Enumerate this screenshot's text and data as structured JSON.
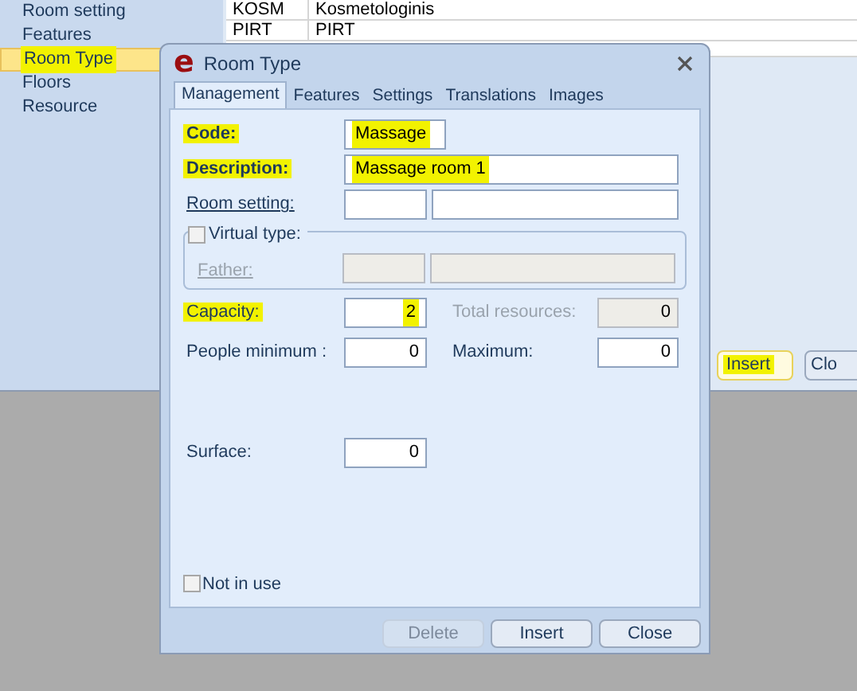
{
  "sidebar": {
    "items": [
      {
        "label": "Room setting",
        "selected": false,
        "highlighted": false
      },
      {
        "label": "Features",
        "selected": false,
        "highlighted": false
      },
      {
        "label": "Room Type",
        "selected": true,
        "highlighted": true
      },
      {
        "label": "Floors",
        "selected": false,
        "highlighted": false
      },
      {
        "label": "Resource",
        "selected": false,
        "highlighted": false
      }
    ]
  },
  "table": {
    "rows": [
      {
        "cells": [
          "KOSM",
          "Kosmetologinis"
        ]
      },
      {
        "cells": [
          "PIRT",
          "PIRT"
        ]
      }
    ]
  },
  "background_buttons": [
    {
      "label": "Insert",
      "highlighted": true
    },
    {
      "label": "Clo",
      "highlighted": false
    }
  ],
  "dialog": {
    "logo": "e",
    "title": "Room Type",
    "tabs": [
      {
        "label": "Management",
        "selected": true
      },
      {
        "label": "Features",
        "selected": false
      },
      {
        "label": "Settings",
        "selected": false
      },
      {
        "label": "Translations",
        "selected": false
      },
      {
        "label": "Images",
        "selected": false
      }
    ],
    "code": {
      "label": "Code:",
      "value": "Massage",
      "required": true,
      "label_highlighted": true,
      "value_highlighted": true
    },
    "description": {
      "label": "Description:",
      "value": "Massage room 1",
      "required": true,
      "label_highlighted": true,
      "value_highlighted": true
    },
    "room_setting": {
      "label": "Room setting:"
    },
    "virtual_type": {
      "label": "Virtual type:",
      "checked": false
    },
    "father": {
      "label": "Father:",
      "disabled": true
    },
    "capacity": {
      "label": "Capacity:",
      "value": "2",
      "label_highlighted": true,
      "value_highlighted": true
    },
    "total_resources": {
      "label": "Total resources:",
      "value": "0",
      "disabled": true
    },
    "people_minimum": {
      "label": "People minimum :",
      "value": "0"
    },
    "maximum": {
      "label": "Maximum:",
      "value": "0"
    },
    "surface": {
      "label": "Surface:",
      "value": "0"
    },
    "not_in_use": {
      "label": "Not in use",
      "checked": false
    },
    "buttons": [
      {
        "label": "Delete",
        "disabled": true
      },
      {
        "label": "Insert",
        "disabled": false
      },
      {
        "label": "Close",
        "disabled": false
      }
    ]
  }
}
